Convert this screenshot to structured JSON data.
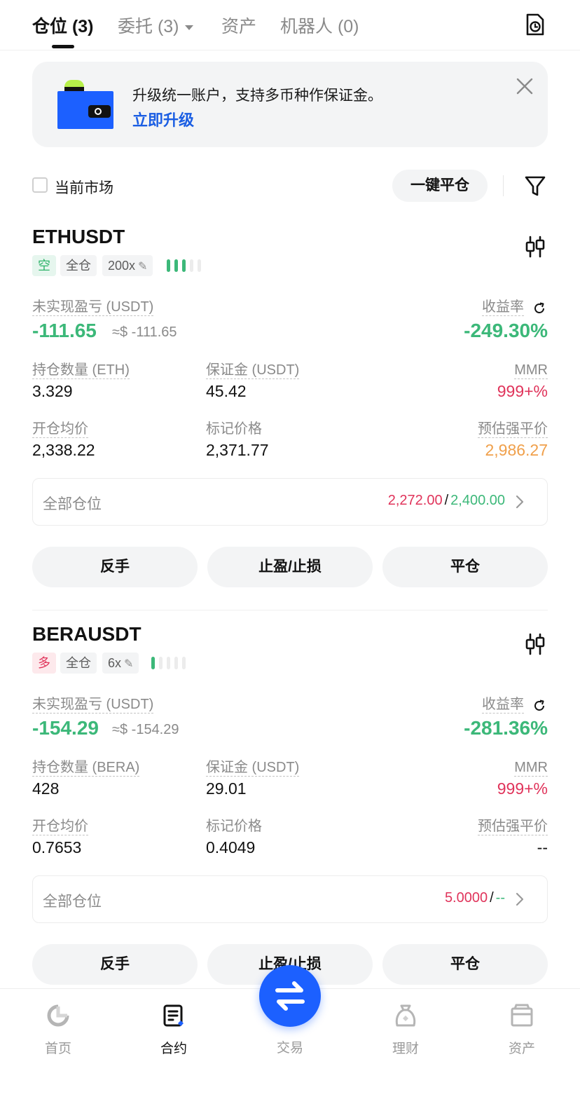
{
  "tabs": [
    {
      "label": "仓位 (3)"
    },
    {
      "label": "委托 (3)"
    },
    {
      "label": "资产"
    },
    {
      "label": "机器人 (0)"
    }
  ],
  "banner": {
    "text": "升级统一账户，支持多币种作保证金。",
    "link": "立即升级"
  },
  "filter": {
    "current_market_label": "当前市场",
    "close_all_label": "一键平仓"
  },
  "positions": [
    {
      "symbol": "ETHUSDT",
      "side_tag": "空",
      "margin_mode": "全仓",
      "leverage": "200x",
      "risk_level": 3,
      "pnl_label": "未实现盈亏 (USDT)",
      "pnl": "-111.65",
      "pnl_usd": "≈$ -111.65",
      "roe_label": "收益率",
      "roe": "-249.30%",
      "qty_label": "持仓数量 (ETH)",
      "qty": "3.329",
      "margin_label": "保证金 (USDT)",
      "margin": "45.42",
      "mmr_label": "MMR",
      "mmr": "999+%",
      "entry_label": "开仓均价",
      "entry": "2,338.22",
      "mark_label": "标记价格",
      "mark": "2,371.77",
      "liq_label": "预估强平价",
      "liq": "2,986.27",
      "all_label": "全部仓位",
      "tp": "2,272.00",
      "sl": "2,400.00",
      "btn_reverse": "反手",
      "btn_tpsl": "止盈/止损",
      "btn_close": "平仓"
    },
    {
      "symbol": "BERAUSDT",
      "side_tag": "多",
      "margin_mode": "全仓",
      "leverage": "6x",
      "risk_level": 1,
      "pnl_label": "未实现盈亏 (USDT)",
      "pnl": "-154.29",
      "pnl_usd": "≈$ -154.29",
      "roe_label": "收益率",
      "roe": "-281.36%",
      "qty_label": "持仓数量 (BERA)",
      "qty": "428",
      "margin_label": "保证金 (USDT)",
      "margin": "29.01",
      "mmr_label": "MMR",
      "mmr": "999+%",
      "entry_label": "开仓均价",
      "entry": "0.7653",
      "mark_label": "标记价格",
      "mark": "0.4049",
      "liq_label": "预估强平价",
      "liq": "--",
      "all_label": "全部仓位",
      "tp": "5.0000",
      "sl": "--",
      "btn_reverse": "反手",
      "btn_tpsl": "止盈/止损",
      "btn_close": "平仓"
    }
  ],
  "bottom_nav": [
    {
      "label": "首页",
      "icon": "home-icon"
    },
    {
      "label": "合约",
      "icon": "contract-icon"
    },
    {
      "label": "交易",
      "icon": "swap-icon"
    },
    {
      "label": "理财",
      "icon": "earn-icon"
    },
    {
      "label": "资产",
      "icon": "wallet-icon"
    }
  ],
  "colors": {
    "green": "#3cb879",
    "red": "#e0345b",
    "orange": "#f0a04b",
    "brand_blue": "#1c60ff"
  }
}
